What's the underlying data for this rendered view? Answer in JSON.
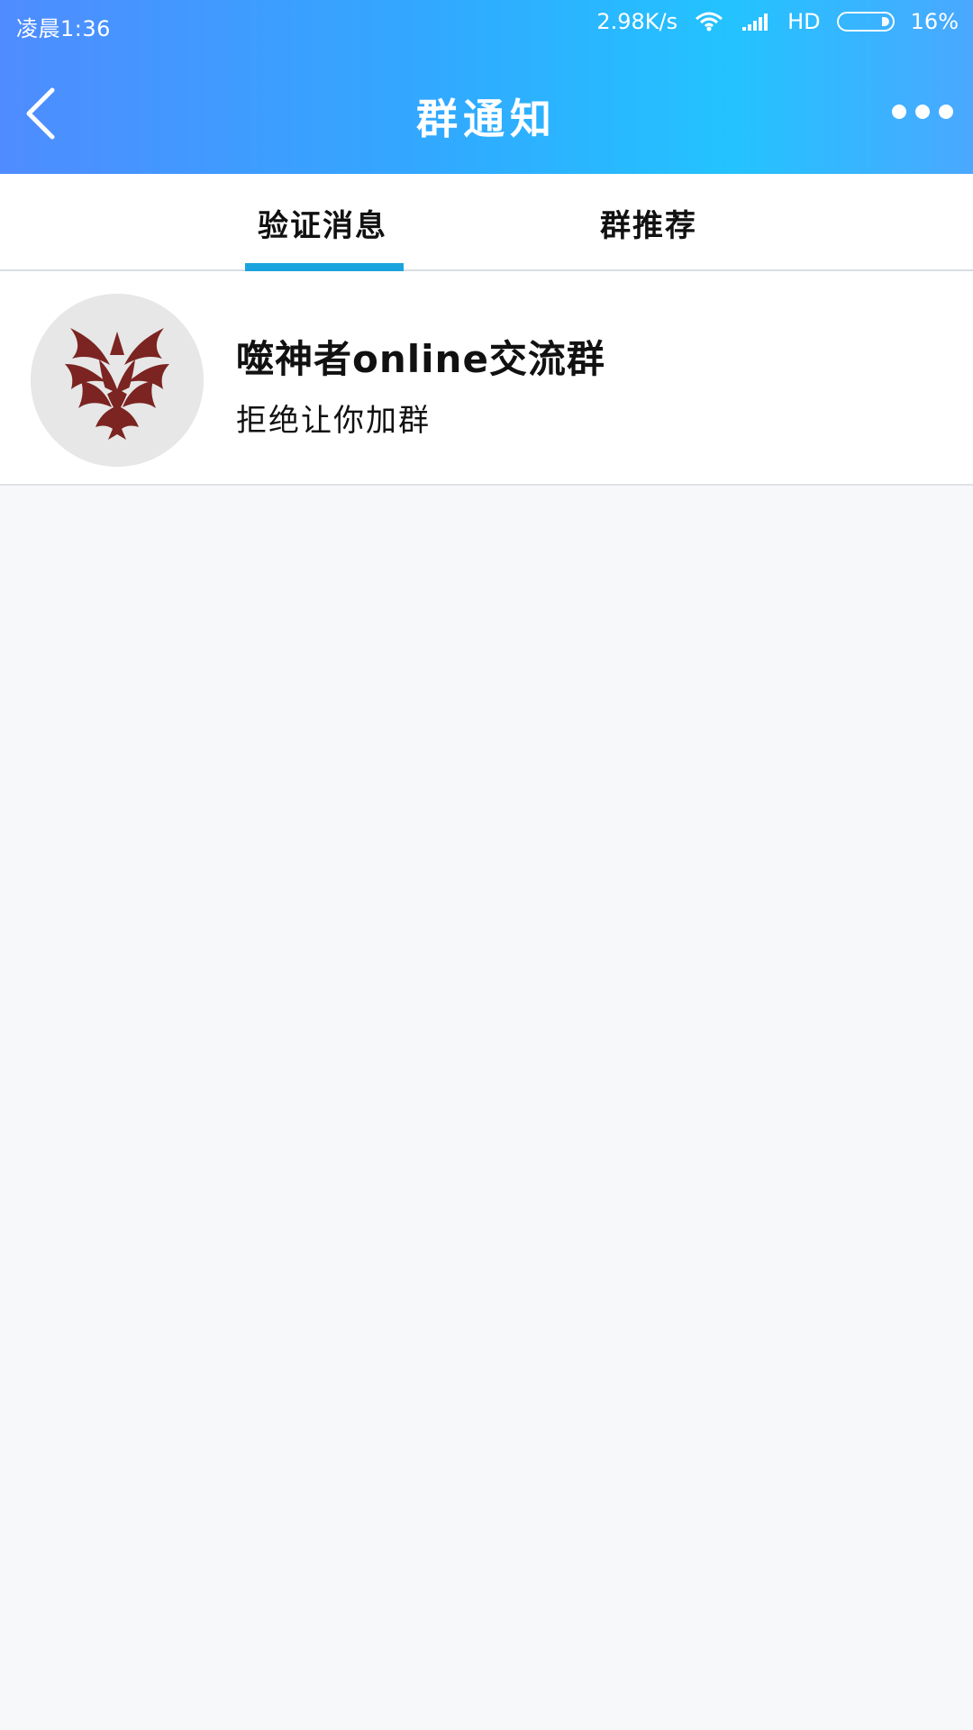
{
  "status_bar": {
    "time": "凌晨1:36",
    "network_speed": "2.98K/s",
    "network_type": "HD",
    "battery": "16%"
  },
  "header": {
    "title": "群通知"
  },
  "tabs": [
    {
      "label": "验证消息",
      "active": true
    },
    {
      "label": "群推荐",
      "active": false
    }
  ],
  "notifications": [
    {
      "group_name": "噬神者online交流群",
      "message": "拒绝让你加群",
      "avatar_icon": "demon-mask-icon"
    }
  ],
  "colors": {
    "header_gradient_start": "#4f8cff",
    "header_gradient_end": "#23c3ff",
    "active_tab_indicator": "#1aa4dd",
    "page_background": "#f7f8fa"
  }
}
